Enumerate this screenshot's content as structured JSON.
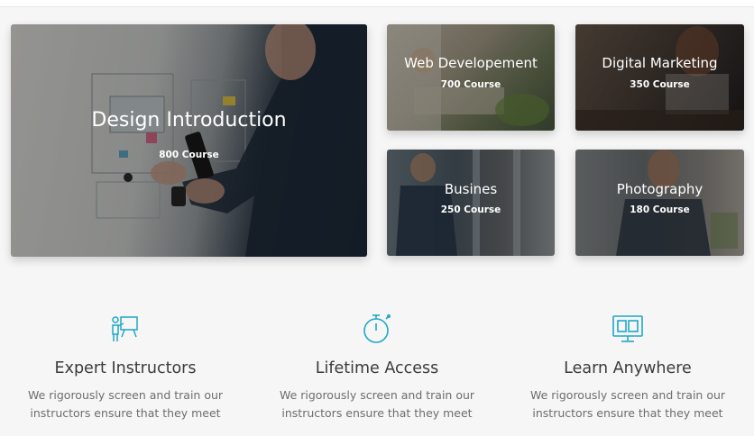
{
  "categories": [
    {
      "id": "design",
      "title": "Design Introduction",
      "count": "800 Course"
    },
    {
      "id": "web",
      "title": "Web Developement",
      "count": "700 Course"
    },
    {
      "id": "marketing",
      "title": "Digital Marketing",
      "count": "350 Course"
    },
    {
      "id": "business",
      "title": "Busines",
      "count": "250 Course"
    },
    {
      "id": "photography",
      "title": "Photography",
      "count": "180 Course"
    }
  ],
  "features": [
    {
      "icon": "instructor-board-icon",
      "title": "Expert Instructors",
      "desc": "We rigorously screen and train our instructors ensure that they meet"
    },
    {
      "icon": "stopwatch-icon",
      "title": "Lifetime Access",
      "desc": "We rigorously screen and train our instructors ensure that they meet"
    },
    {
      "icon": "monitor-icon",
      "title": "Learn Anywhere",
      "desc": "We rigorously screen and train our instructors ensure that they meet"
    }
  ],
  "colors": {
    "accent": "#1fa7c8",
    "heading": "#3b3b3b",
    "body": "#6d6d6d",
    "background": "#f6f6f6"
  }
}
